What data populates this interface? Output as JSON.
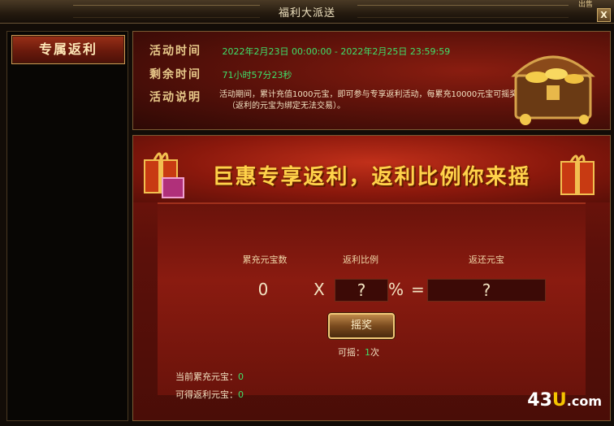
{
  "window": {
    "title": "福利大派送",
    "close_label": "X",
    "corner_mark": "出售"
  },
  "sidebar": {
    "tab_label": "专属返利"
  },
  "info": {
    "time_label": "活动时间",
    "time_value": "2022年2月23日 00:00:00 - 2022年2月25日 23:59:59",
    "remain_label": "剩余时间",
    "remain_value": "71小时57分23秒",
    "desc_label": "活动说明",
    "desc_line1": "活动期间，累计充值1000元宝，即可参与专享返利活动，每累充10000元宝可摇奖1次",
    "desc_line2": "（返利的元宝为绑定无法交易）。"
  },
  "banner": {
    "headline": "巨惠专享返利，返利比例你来摇"
  },
  "calc": {
    "col1_header": "累充元宝数",
    "col2_header": "返利比例",
    "col3_header": "返还元宝",
    "col1_value": "0",
    "times_sign": "X",
    "col2_value": "?",
    "percent_sign": "%",
    "equals_sign": "=",
    "col3_value": "?"
  },
  "spin": {
    "button_label": "摇奖",
    "remaining_label": "可摇：",
    "remaining_count": "1",
    "remaining_unit": "次"
  },
  "footer": {
    "current_label": "当前累充元宝：",
    "current_value": "0",
    "gain_label": "可得返利元宝：",
    "gain_value": "0"
  },
  "watermark": {
    "part1": "43",
    "part2": "U",
    "part3": ".com"
  },
  "colors": {
    "value_green": "#3fe06a",
    "headline_gold": "#ffd24a",
    "panel_red": "#7a160c"
  }
}
